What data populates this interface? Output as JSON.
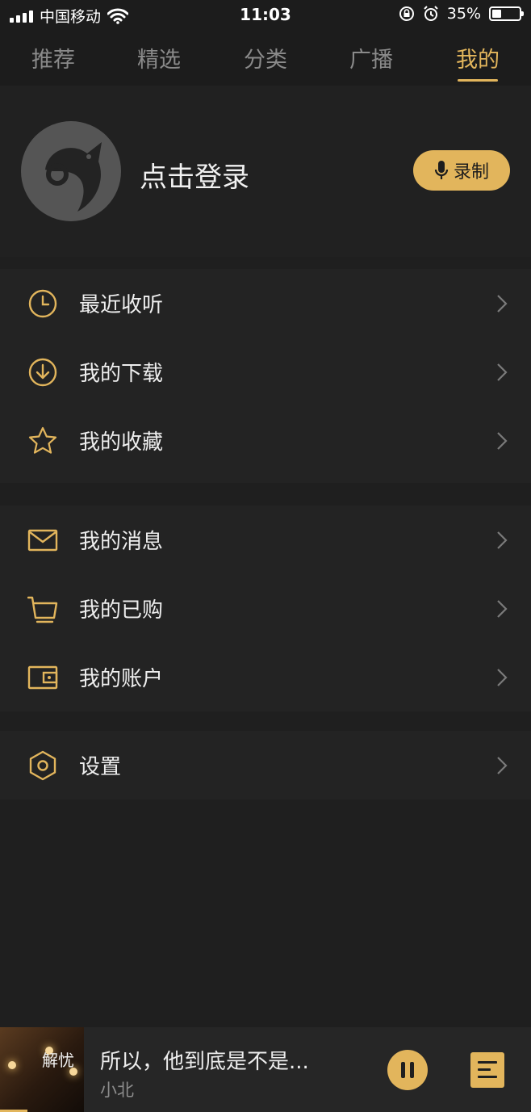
{
  "status_bar": {
    "carrier": "中国移动",
    "time": "11:03",
    "battery_percent": "35%",
    "battery_level": 0.35
  },
  "tabs": [
    {
      "label": "推荐",
      "active": false
    },
    {
      "label": "精选",
      "active": false
    },
    {
      "label": "分类",
      "active": false
    },
    {
      "label": "广播",
      "active": false
    },
    {
      "label": "我的",
      "active": true
    }
  ],
  "profile": {
    "login_text": "点击登录",
    "record_label": "录制"
  },
  "menu_groups": [
    [
      {
        "label": "最近收听",
        "icon": "clock-icon"
      },
      {
        "label": "我的下载",
        "icon": "download-icon"
      },
      {
        "label": "我的收藏",
        "icon": "star-icon"
      }
    ],
    [
      {
        "label": "我的消息",
        "icon": "mail-icon"
      },
      {
        "label": "我的已购",
        "icon": "cart-icon"
      },
      {
        "label": "我的账户",
        "icon": "wallet-icon"
      }
    ],
    [
      {
        "label": "设置",
        "icon": "settings-icon"
      }
    ]
  ],
  "player": {
    "song_title": "所以，他到底是不是...",
    "artist": "小北",
    "cover_text": "解忧"
  },
  "colors": {
    "accent": "#e2b55c",
    "background": "#1f1f1f",
    "section": "#232323"
  }
}
